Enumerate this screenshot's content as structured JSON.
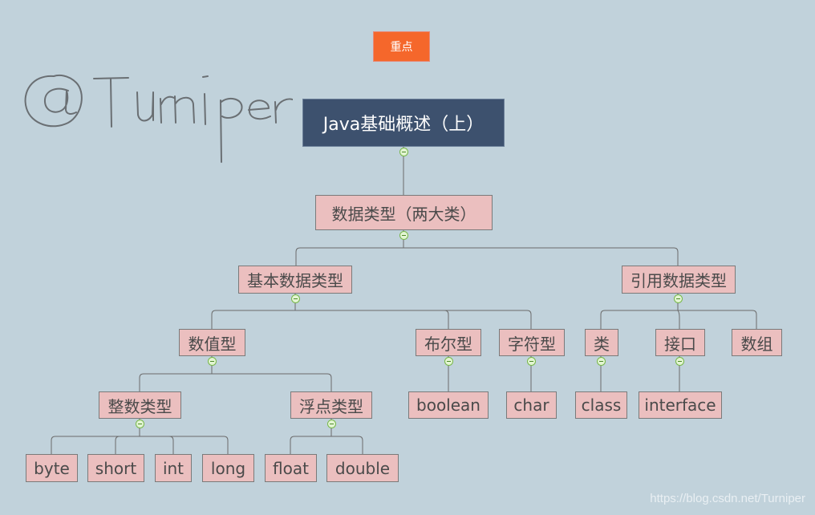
{
  "tag": {
    "label": "重点",
    "color": "#f5672b"
  },
  "signature": {
    "text": "@Turniper"
  },
  "watermark": {
    "text": "https://blog.csdn.net/Turniper"
  },
  "colors": {
    "background": "#c1d2db",
    "root_fill": "#3d516e",
    "node_fill": "#ebbfbf",
    "line": "#6b6b6b",
    "collapse": "#78b84a"
  },
  "tree": {
    "root": "Java基础概述（上）",
    "level1": "数据类型（两大类）",
    "primitive": "基本数据类型",
    "reference": "引用数据类型",
    "numeric": "数值型",
    "boolean_type": "布尔型",
    "char_type": "字符型",
    "integer": "整数类型",
    "floating": "浮点类型",
    "boolean": "boolean",
    "char": "char",
    "byte": "byte",
    "short": "short",
    "int": "int",
    "long": "long",
    "float": "float",
    "double": "double",
    "class_cn": "类",
    "interface_cn": "接口",
    "array_cn": "数组",
    "class": "class",
    "interface": "interface"
  }
}
